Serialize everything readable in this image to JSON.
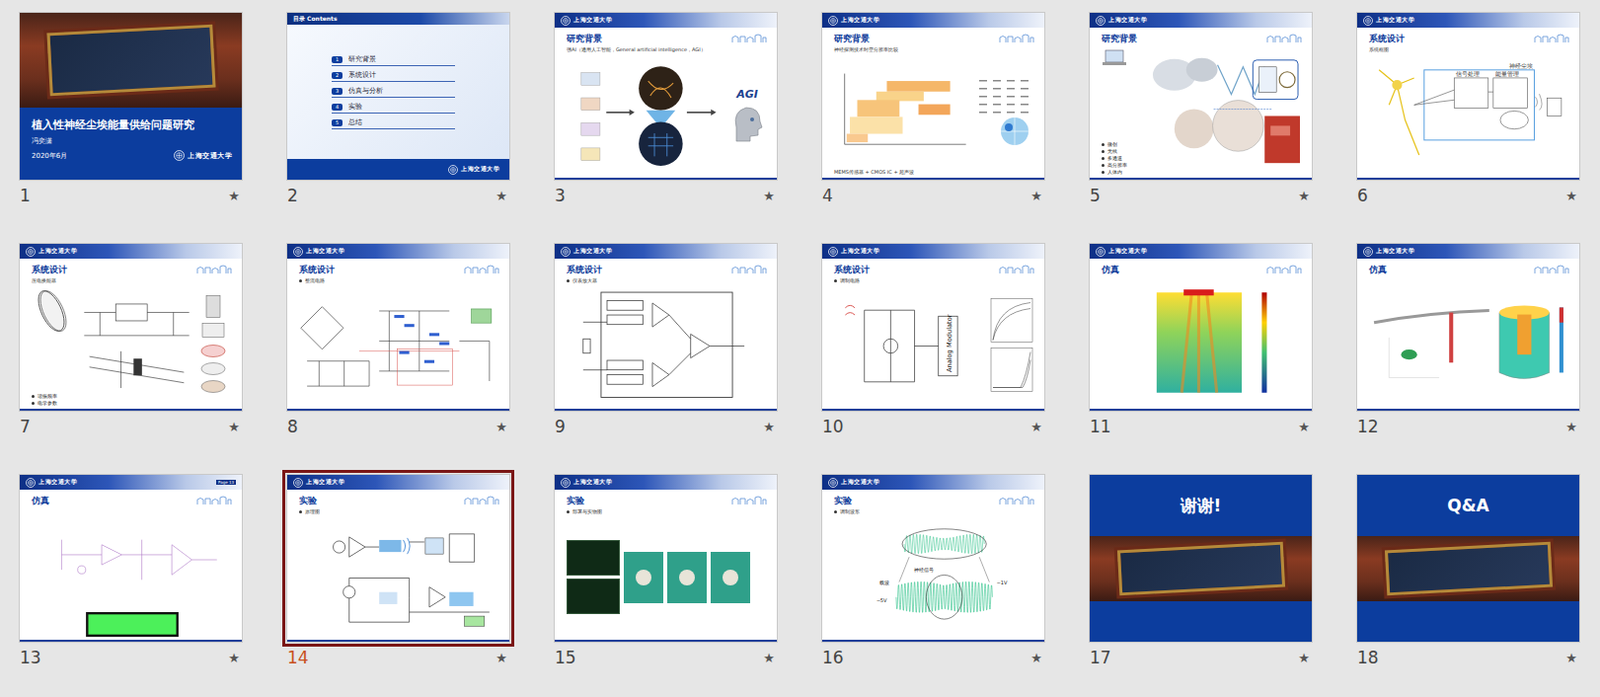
{
  "app": {
    "view": "slide-sorter"
  },
  "logo_text": "上海交通大学",
  "slide_marker": "★",
  "slides": [
    {
      "number": "1",
      "kind": "title",
      "selected": false,
      "title": "植入性神经尘埃能量供给问题研究",
      "author": "冯奕潇",
      "date": "2020年6月"
    },
    {
      "number": "2",
      "kind": "toc",
      "selected": false,
      "title": "目录 Contents",
      "items": [
        {
          "index": "1",
          "label": "研究背景"
        },
        {
          "index": "2",
          "label": "系统设计"
        },
        {
          "index": "3",
          "label": "仿真与分析"
        },
        {
          "index": "4",
          "label": "实验"
        },
        {
          "index": "5",
          "label": "总结"
        }
      ]
    },
    {
      "number": "3",
      "kind": "content",
      "selected": false,
      "title": "研究背景",
      "subtitle": {
        "text": "强AI（通用人工智能，General artificial intelligence，AGI）",
        "bullet": false
      },
      "bullets": [],
      "figure": "agi",
      "figure_labels": [
        "AGI"
      ]
    },
    {
      "number": "4",
      "kind": "content",
      "selected": false,
      "title": "研究背景",
      "subtitle": {
        "text": "神经探测技术时空分辨率比较",
        "bullet": false
      },
      "bullets": [],
      "figure": "chart",
      "figure_labels": [
        "MEMS传感器 + CMOS IC + 超声波"
      ]
    },
    {
      "number": "5",
      "kind": "content",
      "selected": false,
      "title": "研究背景",
      "bullets": [
        "微创",
        "无线",
        "多通道",
        "高分辨率",
        "人体内"
      ],
      "figure": "overview",
      "figure_labels": []
    },
    {
      "number": "6",
      "kind": "content",
      "selected": false,
      "title": "系统设计",
      "subtitle": {
        "text": "系统框图",
        "bullet": false
      },
      "bullets": [],
      "figure": "block",
      "figure_labels": [
        "信号处理",
        "能量管理",
        "神经尘埃"
      ]
    },
    {
      "number": "7",
      "kind": "content",
      "selected": false,
      "title": "系统设计",
      "subtitle": {
        "text": "压电换能器",
        "bullet": false
      },
      "bullets": [
        "谐振频率",
        "电学参数"
      ],
      "figure": "piezo",
      "figure_labels": []
    },
    {
      "number": "8",
      "kind": "content",
      "selected": false,
      "title": "系统设计",
      "subtitle": {
        "text": "整流电路",
        "bullet": true
      },
      "bullets": [],
      "figure": "rectifier",
      "figure_labels": []
    },
    {
      "number": "9",
      "kind": "content",
      "selected": false,
      "title": "系统设计",
      "subtitle": {
        "text": "仪表放大器",
        "bullet": true
      },
      "bullets": [],
      "figure": "amplifier",
      "figure_labels": []
    },
    {
      "number": "10",
      "kind": "content",
      "selected": false,
      "title": "系统设计",
      "subtitle": {
        "text": "调制电路",
        "bullet": true
      },
      "bullets": [],
      "figure": "modulator",
      "figure_labels": [
        "Analog Modulator"
      ]
    },
    {
      "number": "11",
      "kind": "content",
      "selected": false,
      "title": "仿真",
      "bullets": [],
      "figure": "heatmap",
      "figure_labels": []
    },
    {
      "number": "12",
      "kind": "content",
      "selected": false,
      "title": "仿真",
      "bullets": [],
      "figure": "fem",
      "figure_labels": []
    },
    {
      "number": "13",
      "kind": "content",
      "selected": false,
      "title": "仿真",
      "header_note": "Page 13",
      "bullets": [],
      "figure": "sim",
      "figure_labels": []
    },
    {
      "number": "14",
      "kind": "content",
      "selected": true,
      "title": "实验",
      "subtitle": {
        "text": "原理图",
        "bullet": true
      },
      "bullets": [],
      "figure": "schematic",
      "figure_labels": []
    },
    {
      "number": "15",
      "kind": "content",
      "selected": false,
      "title": "实验",
      "subtitle": {
        "text": "部署与实物图",
        "bullet": true
      },
      "bullets": [],
      "figure": "pcb",
      "figure_labels": []
    },
    {
      "number": "16",
      "kind": "content",
      "selected": false,
      "title": "实验",
      "subtitle": {
        "text": "调制波形",
        "bullet": true
      },
      "bullets": [],
      "figure": "wave",
      "figure_labels": [
        "神经信号",
        "载波",
        "~1V",
        "~5V"
      ]
    },
    {
      "number": "17",
      "kind": "end",
      "selected": false,
      "title": "谢谢!"
    },
    {
      "number": "18",
      "kind": "end",
      "selected": false,
      "title": "Q&A"
    }
  ]
}
